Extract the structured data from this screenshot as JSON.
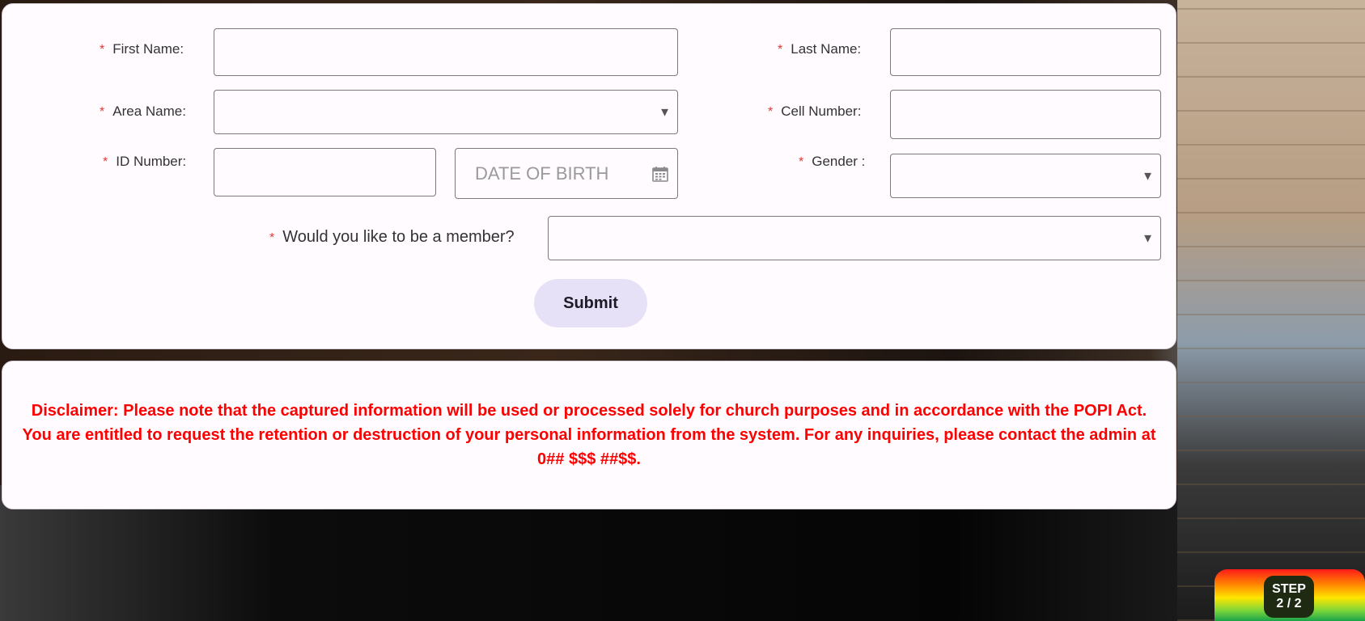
{
  "form": {
    "first_name_label": "First Name:",
    "last_name_label": "Last Name:",
    "area_name_label": "Area Name:",
    "cell_number_label": "Cell Number:",
    "id_number_label": "ID Number:",
    "gender_label": "Gender :",
    "member_label": "Would you like to be a member?",
    "dob_placeholder": "DATE OF BIRTH",
    "required_marker": "*",
    "caret": "▼",
    "submit_label": "Submit"
  },
  "disclaimer": {
    "text": "Disclaimer: Please note that the captured information will be used or processed solely for church purposes and in accordance with the POPI Act. You are entitled to request the retention or destruction of your personal information from the system. For any inquiries, please contact the admin at 0## $$$ ##$$."
  },
  "step": {
    "title": "STEP",
    "progress": "2 / 2"
  },
  "colors": {
    "required": "#e53935",
    "disclaimer_text": "#ff0000",
    "submit_bg": "#e7e1f7"
  }
}
